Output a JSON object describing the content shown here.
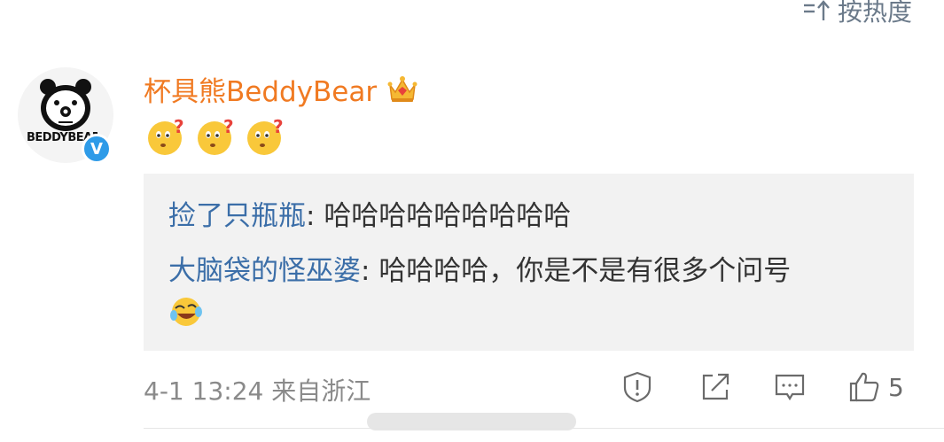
{
  "header": {
    "sort_label": "按热度",
    "sort_icon": "sort-icon"
  },
  "comment": {
    "avatar_text": "BEDDYBEAR",
    "verified_badge": "V",
    "username": "杯具熊BeddyBear",
    "username_color": "#f07a22",
    "badge_icon": "crown-icon",
    "content_emojis": [
      "confused-face-icon",
      "confused-face-icon",
      "confused-face-icon"
    ],
    "replies": [
      {
        "user": "捡了只瓶瓶",
        "separator": ": ",
        "text": "哈哈哈哈哈哈哈哈哈"
      },
      {
        "user": "大脑袋的怪巫婆",
        "separator": ": ",
        "text": "哈哈哈哈，你是不是有很多个问号",
        "trailing_emoji": "laugh-cry-icon"
      }
    ],
    "timestamp": "4-1 13:24",
    "location": "来自浙江",
    "like_count": "5"
  },
  "colors": {
    "reply_user": "#3b6ea8",
    "reply_bg": "#f2f2f2",
    "meta_text": "#8a8a8a",
    "verified_blue": "#2e9be8"
  }
}
